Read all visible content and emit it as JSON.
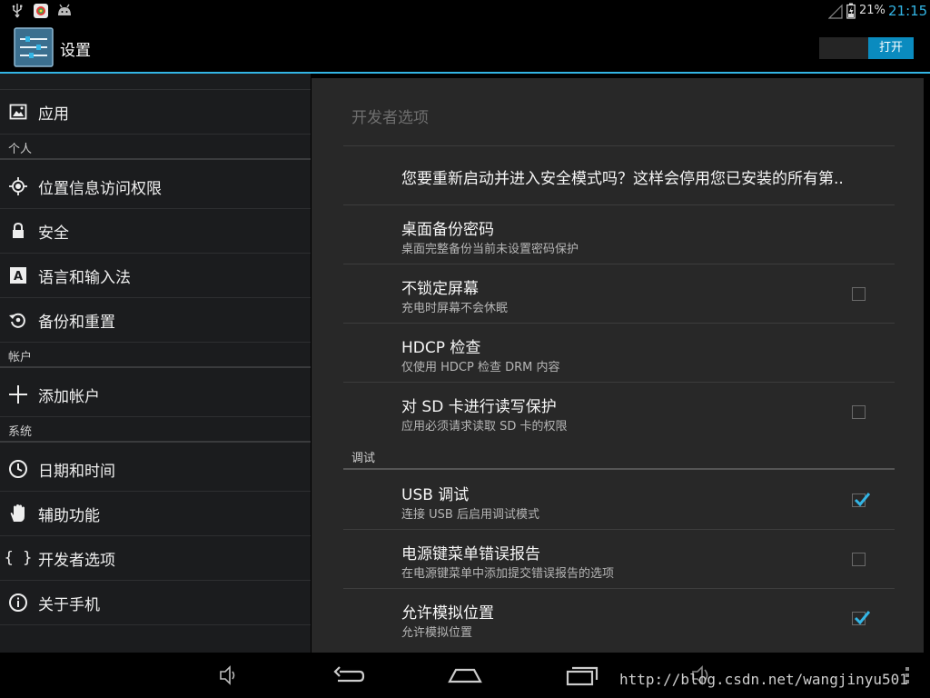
{
  "status": {
    "battery": "21%",
    "time": "21:15"
  },
  "app": {
    "title": "设置",
    "toggle_label": "打开"
  },
  "categories": [
    {
      "type": "item",
      "icon": "apps-icon",
      "label": "应用"
    },
    {
      "type": "header",
      "label": "个人"
    },
    {
      "type": "item",
      "icon": "location-icon",
      "label": "位置信息访问权限"
    },
    {
      "type": "item",
      "icon": "lock-icon",
      "label": "安全"
    },
    {
      "type": "item",
      "icon": "language-icon",
      "label": "语言和输入法"
    },
    {
      "type": "item",
      "icon": "backup-icon",
      "label": "备份和重置"
    },
    {
      "type": "header",
      "label": "帐户"
    },
    {
      "type": "item",
      "icon": "add-icon",
      "label": "添加帐户"
    },
    {
      "type": "header",
      "label": "系统"
    },
    {
      "type": "item",
      "icon": "clock-icon",
      "label": "日期和时间"
    },
    {
      "type": "item",
      "icon": "hand-icon",
      "label": "辅助功能"
    },
    {
      "type": "item",
      "icon": "braces-icon",
      "label": "开发者选项"
    },
    {
      "type": "item",
      "icon": "info-icon",
      "label": "关于手机"
    }
  ],
  "panel": {
    "title": "开发者选项",
    "prefs": [
      {
        "title": "您要重新启动并进入安全模式吗？这样会停用您已安装的所有第..",
        "summary": "",
        "checkbox": null
      },
      {
        "title": "桌面备份密码",
        "summary": "桌面完整备份当前未设置密码保护",
        "checkbox": null
      },
      {
        "title": "不锁定屏幕",
        "summary": "充电时屏幕不会休眠",
        "checkbox": false
      },
      {
        "title": "HDCP 检查",
        "summary": "仅使用 HDCP 检查 DRM 内容",
        "checkbox": null
      },
      {
        "title": "对 SD 卡进行读写保护",
        "summary": "应用必须请求读取 SD 卡的权限",
        "checkbox": false
      }
    ],
    "section_label": "调试",
    "debug_prefs": [
      {
        "title": "USB 调试",
        "summary": "连接 USB 后启用调试模式",
        "checkbox": true
      },
      {
        "title": "电源键菜单错误报告",
        "summary": "在电源键菜单中添加提交错误报告的选项",
        "checkbox": false
      },
      {
        "title": "允许模拟位置",
        "summary": "允许模拟位置",
        "checkbox": true
      }
    ]
  },
  "watermark": "http://blog.csdn.net/wangjinyu501",
  "colors": {
    "accent": "#33b5e5",
    "toggle_on": "#0a8bbf"
  }
}
